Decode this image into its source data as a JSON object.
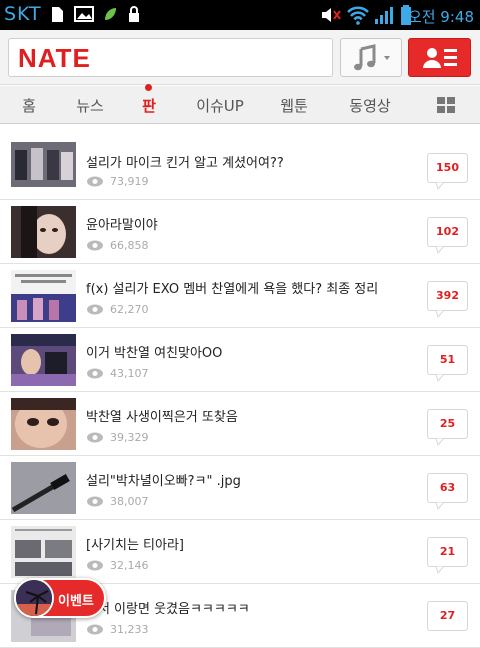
{
  "status_bar": {
    "carrier": "SKT",
    "time": "오전 9:48",
    "icons": [
      "sd-card-icon",
      "image-icon",
      "leaf-icon",
      "lock-icon",
      "mute-icon",
      "wifi-icon",
      "signal-icon",
      "battery-icon"
    ]
  },
  "header": {
    "logo": "NATE",
    "music_icon": "music-note-icon",
    "user_icon": "user-list-icon"
  },
  "tabs": [
    {
      "label": "홈",
      "active": false
    },
    {
      "label": "뉴스",
      "active": false
    },
    {
      "label": "판",
      "active": true
    },
    {
      "label": "이슈UP",
      "active": false
    },
    {
      "label": "웹툰",
      "active": false
    },
    {
      "label": "동영상",
      "active": false
    }
  ],
  "grid_icon": "grid-icon",
  "posts": [
    {
      "title": "설리가 마이크 킨거 알고 계셨어여??",
      "views": "73,919",
      "comments": "150"
    },
    {
      "title": "윤아라말이야",
      "views": "66,858",
      "comments": "102"
    },
    {
      "title": "f(x) 설리가 EXO 멤버 찬열에게 욕을 했다? 최종 정리",
      "views": "62,270",
      "comments": "392"
    },
    {
      "title": "이거 박찬열 여친맞아OO",
      "views": "43,107",
      "comments": "51"
    },
    {
      "title": "박찬열 사생이찍은거 또찾음",
      "views": "39,329",
      "comments": "25"
    },
    {
      "title": "설리\"박차녈이오빠?ㅋ\" .jpg",
      "views": "38,007",
      "comments": "63"
    },
    {
      "title": "[사기치는 티아라]",
      "views": "32,146",
      "comments": "21"
    },
    {
      "title": "에서 이랑면 웃겼음ㅋㅋㅋㅋㅋ",
      "views": "31,233",
      "comments": "27"
    }
  ],
  "event_button": {
    "label": "이벤트"
  },
  "colors": {
    "brand_red": "#e02020",
    "header_bg": "#f3f3f3"
  }
}
